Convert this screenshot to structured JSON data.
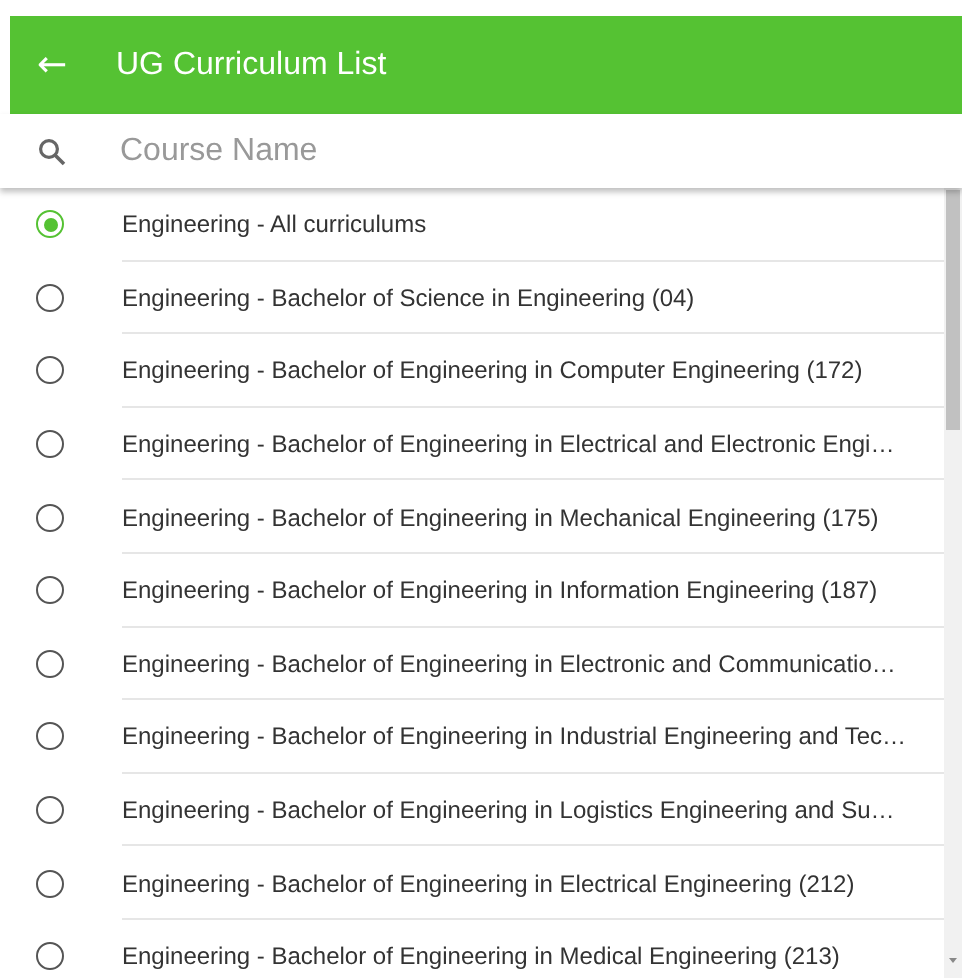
{
  "header": {
    "back_icon": "←",
    "title": "UG Curriculum List"
  },
  "search": {
    "placeholder": "Course Name"
  },
  "items": [
    {
      "label": "Engineering - All curriculums",
      "selected": true
    },
    {
      "label": "Engineering - Bachelor of Science in Engineering (04)",
      "selected": false
    },
    {
      "label": "Engineering - Bachelor of Engineering in Computer Engineering (172)",
      "selected": false
    },
    {
      "label": "Engineering - Bachelor of Engineering in Electrical and Electronic Engi…",
      "selected": false
    },
    {
      "label": "Engineering - Bachelor of Engineering in Mechanical Engineering (175)",
      "selected": false
    },
    {
      "label": "Engineering - Bachelor of Engineering in Information Engineering (187)",
      "selected": false
    },
    {
      "label": "Engineering - Bachelor of Engineering in Electronic and Communicatio…",
      "selected": false
    },
    {
      "label": "Engineering - Bachelor of Engineering in Industrial Engineering and Tec…",
      "selected": false
    },
    {
      "label": "Engineering - Bachelor of Engineering in Logistics Engineering and Su…",
      "selected": false
    },
    {
      "label": "Engineering - Bachelor of Engineering in Electrical Engineering (212)",
      "selected": false
    },
    {
      "label": "Engineering - Bachelor of Engineering in Medical Engineering (213)",
      "selected": false
    }
  ]
}
